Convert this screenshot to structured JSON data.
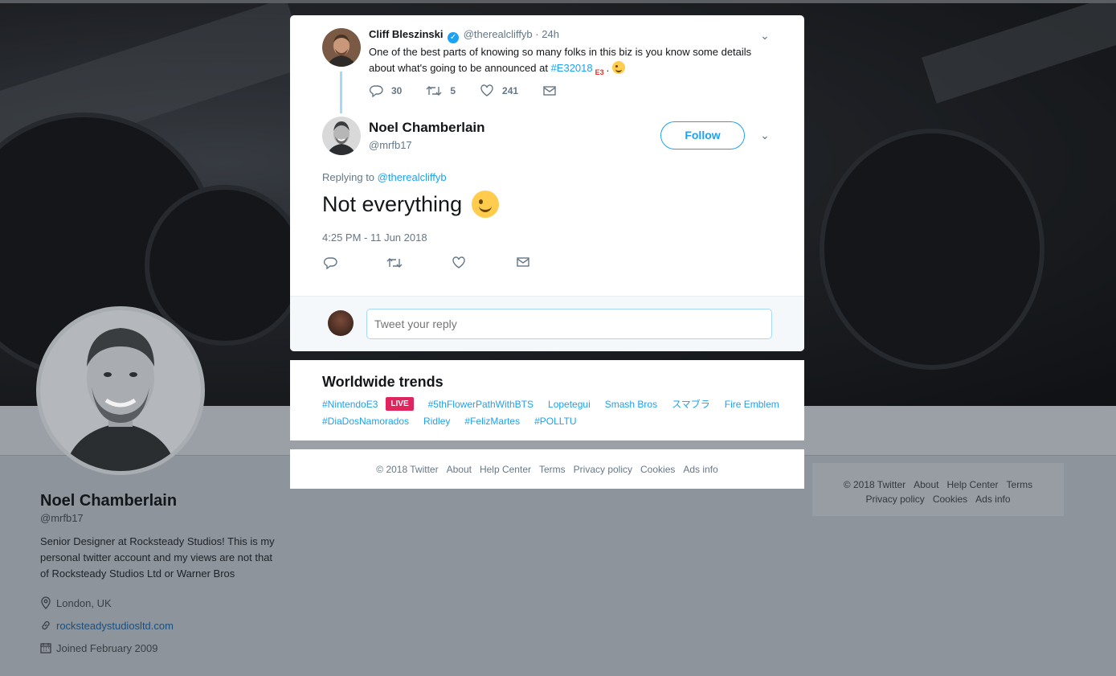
{
  "background_profile": {
    "name": "Noel Chamberlain",
    "handle": "@mrfb17",
    "bio": "Senior Designer at Rocksteady Studios! This is my personal twitter account and my views are not that of Rocksteady Studios Ltd or Warner Bros",
    "location": "London, UK",
    "website": "rocksteadystudiosltd.com",
    "joined": "Joined February 2009"
  },
  "side_footer": {
    "line1": [
      "© 2018 Twitter",
      "About",
      "Help Center",
      "Terms"
    ],
    "line2": [
      "Privacy policy",
      "Cookies",
      "Ads info"
    ]
  },
  "parent_tweet": {
    "name": "Cliff Bleszinski",
    "handle": "@therealcliffyb",
    "time": "· 24h",
    "text_before": "One of the best parts of knowing so many folks in this biz is you know some details about what's going to be announced at ",
    "hashtag": "#E32018",
    "e3_badge": "E3",
    "text_after": ".",
    "replies": "30",
    "retweets": "5",
    "likes": "241"
  },
  "main_tweet": {
    "name": "Noel Chamberlain",
    "handle": "@mrfb17",
    "follow_label": "Follow",
    "replying_prefix": "Replying to ",
    "replying_handle": "@therealcliffyb",
    "text": "Not everything",
    "timestamp": "4:25 PM - 11 Jun 2018"
  },
  "reply": {
    "placeholder": "Tweet your reply"
  },
  "trends": {
    "title": "Worldwide trends",
    "row1": [
      "#NintendoE3",
      "#5thFlowerPathWithBTS",
      "Lopetegui",
      "Smash Bros",
      "スマブラ",
      "Fire Emblem"
    ],
    "live_label": "LIVE",
    "row2": [
      "#DiaDosNamorados",
      "Ridley",
      "#FelizMartes",
      "#POLLTU"
    ]
  },
  "footer": [
    "© 2018 Twitter",
    "About",
    "Help Center",
    "Terms",
    "Privacy policy",
    "Cookies",
    "Ads info"
  ],
  "colors": {
    "accent": "#1da1f2",
    "live": "#e0245e",
    "thread": "#a4d9f9"
  }
}
